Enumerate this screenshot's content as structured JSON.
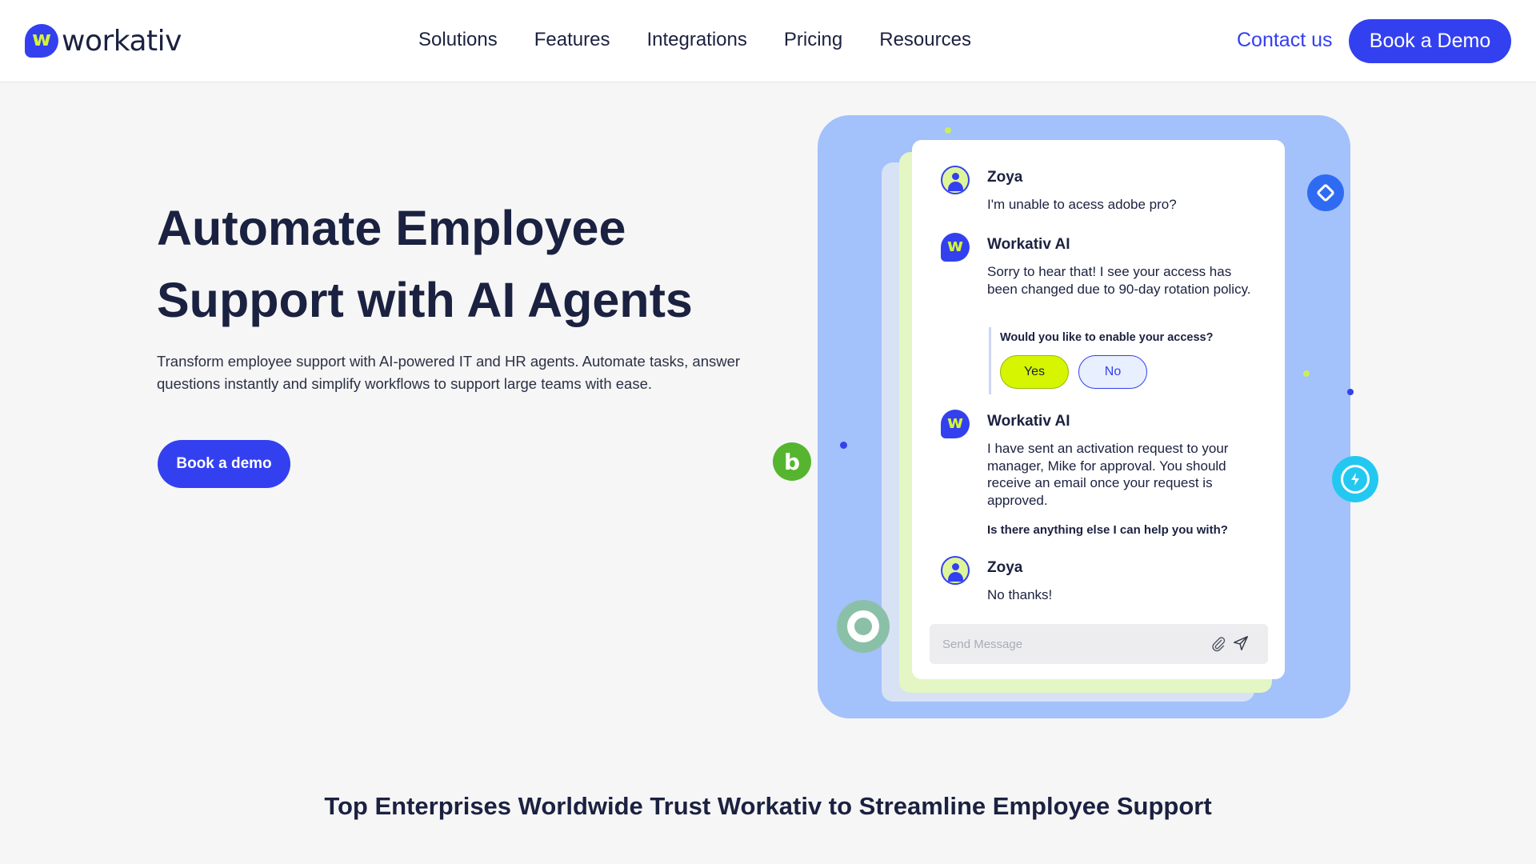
{
  "header": {
    "logo_text": "workativ",
    "logo_mark": "w",
    "nav": [
      "Solutions",
      "Features",
      "Integrations",
      "Pricing",
      "Resources"
    ],
    "contact_label": "Contact us",
    "demo_label": "Book a Demo"
  },
  "hero": {
    "title_line1": "Automate Employee",
    "title_line2": "Support with AI Agents",
    "subtitle": "Transform employee support with AI-powered IT and HR agents. Automate tasks, answer questions instantly and simplify workflows to support large teams with ease.",
    "button_label": "Book a demo"
  },
  "chat": {
    "messages": [
      {
        "name": "Zoya",
        "text": "I'm unable to acess adobe pro?"
      },
      {
        "name": "Workativ AI",
        "text": "Sorry to hear that! I see your access has been changed due to 90-day rotation policy."
      },
      {
        "name": "Workativ AI",
        "text": "I have sent an activation request to your manager, Mike for approval. You should receive an email once your request is approved."
      },
      {
        "name": "Zoya",
        "text": "No thanks!"
      }
    ],
    "quick_question": "Would you like to enable your access?",
    "yes_label": "Yes",
    "no_label": "No",
    "followup": "Is there anything else I can help you with?",
    "input_placeholder": "Send Message"
  },
  "trust_heading": "Top Enterprises Worldwide Trust Workativ to Streamline Employee Support",
  "colors": {
    "brand_blue": "#3340f0",
    "brand_lime": "#d5f500",
    "panel_blue": "#a3c1fb"
  }
}
